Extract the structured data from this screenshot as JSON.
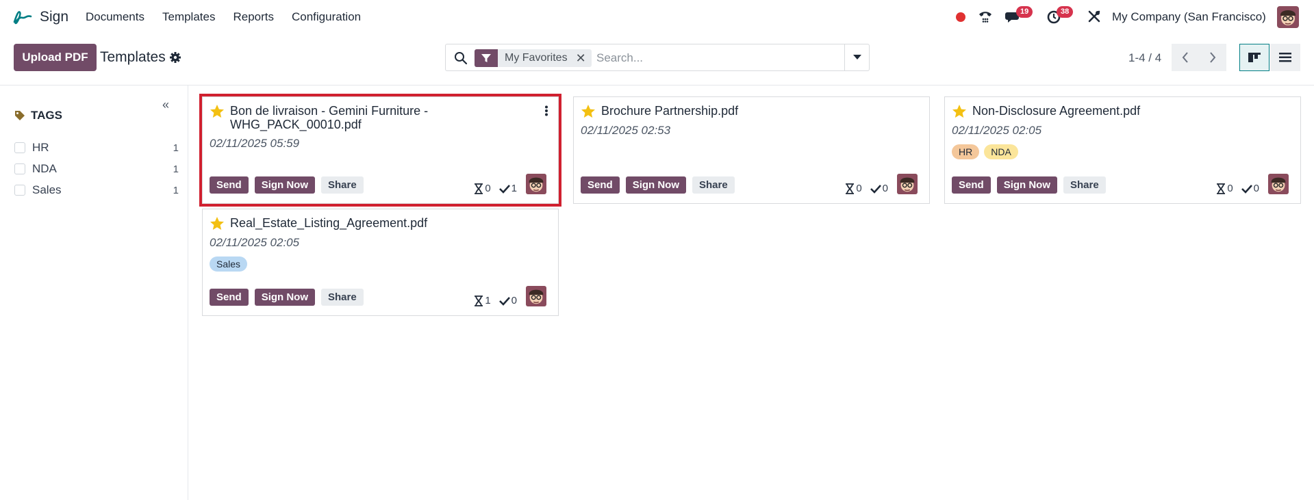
{
  "navbar": {
    "app_name": "Sign",
    "menu": [
      "Documents",
      "Templates",
      "Reports",
      "Configuration"
    ],
    "chat_badge": "19",
    "activity_badge": "38",
    "company": "My Company (San Francisco)"
  },
  "control": {
    "upload_label": "Upload PDF",
    "breadcrumb": "Templates",
    "facet_label": "My Favorites",
    "search_placeholder": "Search...",
    "pager": "1-4 / 4"
  },
  "sidebar": {
    "heading": "TAGS",
    "tags": [
      {
        "label": "HR",
        "count": "1"
      },
      {
        "label": "NDA",
        "count": "1"
      },
      {
        "label": "Sales",
        "count": "1"
      }
    ]
  },
  "cards": [
    {
      "title": "Bon de livraison - Gemini Furniture - WHG_PACK_00010.pdf",
      "date": "02/11/2025 05:59",
      "tags": [],
      "in_progress": "0",
      "signed": "1"
    },
    {
      "title": "Brochure Partnership.pdf",
      "date": "02/11/2025 02:53",
      "tags": [],
      "in_progress": "0",
      "signed": "0"
    },
    {
      "title": "Non-Disclosure Agreement.pdf",
      "date": "02/11/2025 02:05",
      "tags": [
        {
          "label": "HR",
          "color": "#f4c79a"
        },
        {
          "label": "NDA",
          "color": "#fbe59a"
        }
      ],
      "in_progress": "0",
      "signed": "0"
    },
    {
      "title": "Real_Estate_Listing_Agreement.pdf",
      "date": "02/11/2025 02:05",
      "tags": [
        {
          "label": "Sales",
          "color": "#b9d8f3"
        }
      ],
      "in_progress": "1",
      "signed": "0"
    }
  ],
  "actions": {
    "send": "Send",
    "sign_now": "Sign Now",
    "share": "Share"
  },
  "colors": {
    "brand": "#714b67",
    "highlight": "#d0202f",
    "star": "#f3c012"
  }
}
